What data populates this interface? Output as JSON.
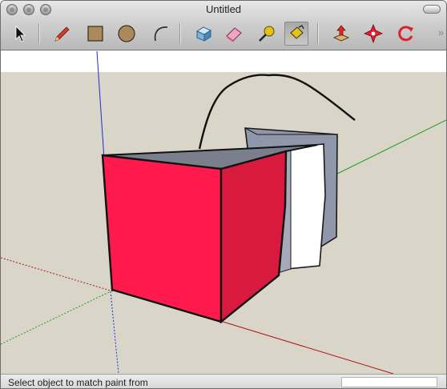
{
  "window": {
    "title": "Untitled"
  },
  "toolbar": {
    "tools": [
      {
        "id": "select",
        "icon": "arrow-cursor-icon",
        "active": false
      },
      {
        "id": "pencil",
        "icon": "pencil-icon",
        "active": false
      },
      {
        "id": "rectangle",
        "icon": "rectangle-icon",
        "active": false
      },
      {
        "id": "circle",
        "icon": "circle-icon",
        "active": false
      },
      {
        "id": "arc",
        "icon": "arc-icon",
        "active": false
      },
      {
        "id": "make-component",
        "icon": "component-box-icon",
        "active": false
      },
      {
        "id": "eraser",
        "icon": "eraser-icon",
        "active": false
      },
      {
        "id": "tape-measure",
        "icon": "tape-measure-icon",
        "active": false
      },
      {
        "id": "paint-bucket",
        "icon": "paint-bucket-icon",
        "active": true
      },
      {
        "id": "push-pull",
        "icon": "push-pull-icon",
        "active": false
      },
      {
        "id": "move",
        "icon": "move-icon",
        "active": false
      },
      {
        "id": "rotate",
        "icon": "rotate-icon",
        "active": false
      }
    ],
    "overflow_icon": "double-chevron-right-icon"
  },
  "canvas": {
    "sky_color": "#ffffff",
    "ground_color": "#d9d6c9",
    "face_colors": {
      "front": "#ff1a4d",
      "side": "#d81a3e",
      "top": "#7a7f8e",
      "white": "#ffffff",
      "grey": "#9aa0b2"
    }
  },
  "status_bar": {
    "message": "Select object to match paint from",
    "measurements_value": ""
  }
}
